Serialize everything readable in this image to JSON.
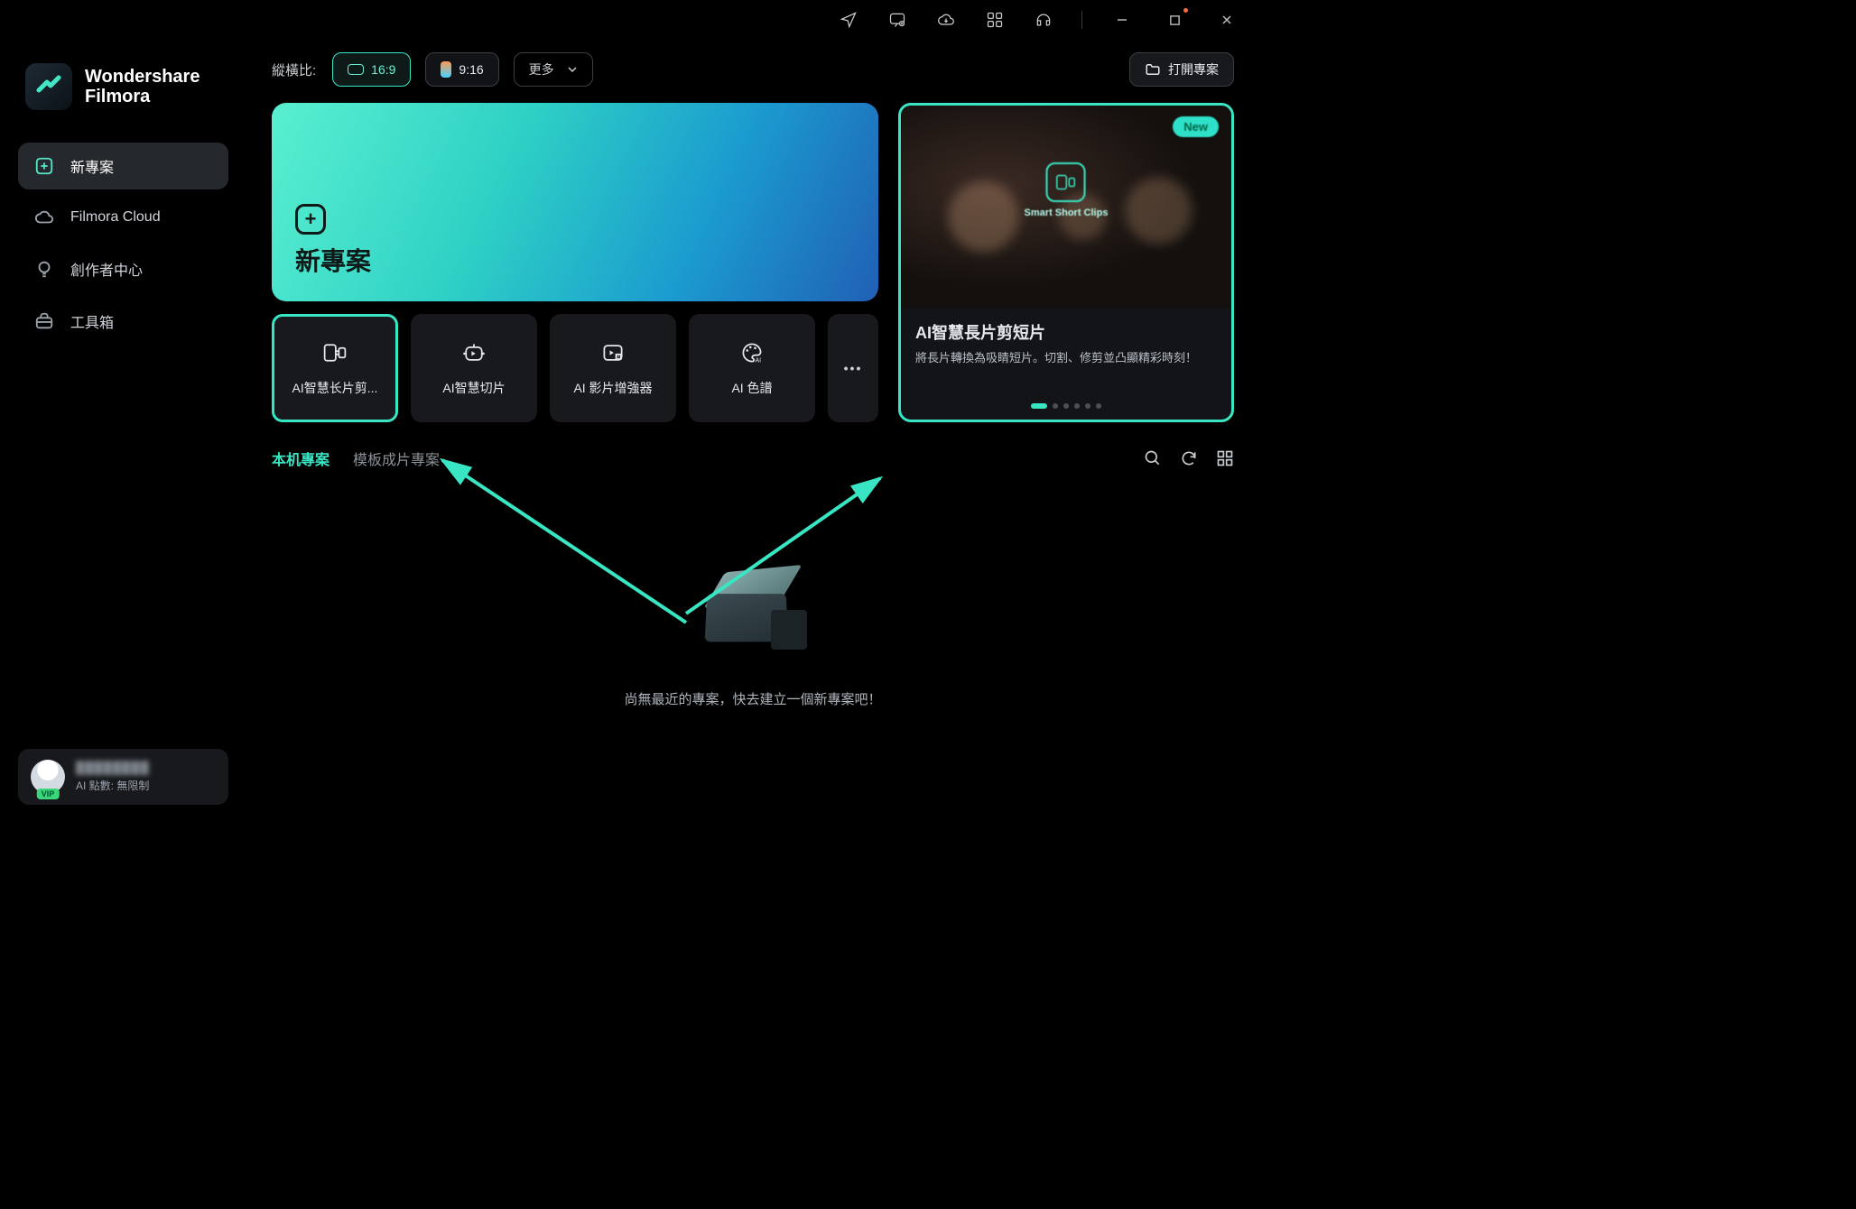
{
  "app": {
    "brand_line1": "Wondershare",
    "brand_line2": "Filmora"
  },
  "sidebar": {
    "items": [
      {
        "label": "新專案"
      },
      {
        "label": "Filmora Cloud"
      },
      {
        "label": "創作者中心"
      },
      {
        "label": "工具箱"
      }
    ]
  },
  "account": {
    "name_masked": "████████",
    "credits_label": "AI 點數: 無限制",
    "vip": "VIP"
  },
  "topbar": {
    "aspect_label": "縱橫比:",
    "ratio_169": "16:9",
    "ratio_916": "9:16",
    "more": "更多",
    "open_project": "打開專案"
  },
  "hero": {
    "new_project_title": "新專案"
  },
  "promo": {
    "badge": "New",
    "center_caption": "Smart Short Clips",
    "title": "AI智慧長片剪短片",
    "desc": "將長片轉換為吸睛短片。切割、修剪並凸顯精彩時刻！",
    "slide_count": 6,
    "active_slide": 0
  },
  "tools": [
    {
      "label": "AI智慧长片剪..."
    },
    {
      "label": "AI智慧切片"
    },
    {
      "label": "AI 影片增強器"
    },
    {
      "label": "AI 色譜"
    }
  ],
  "tabs": {
    "local": "本机專案",
    "template": "模板成片專案"
  },
  "empty": {
    "message": "尚無最近的專案，快去建立一個新專案吧！"
  }
}
